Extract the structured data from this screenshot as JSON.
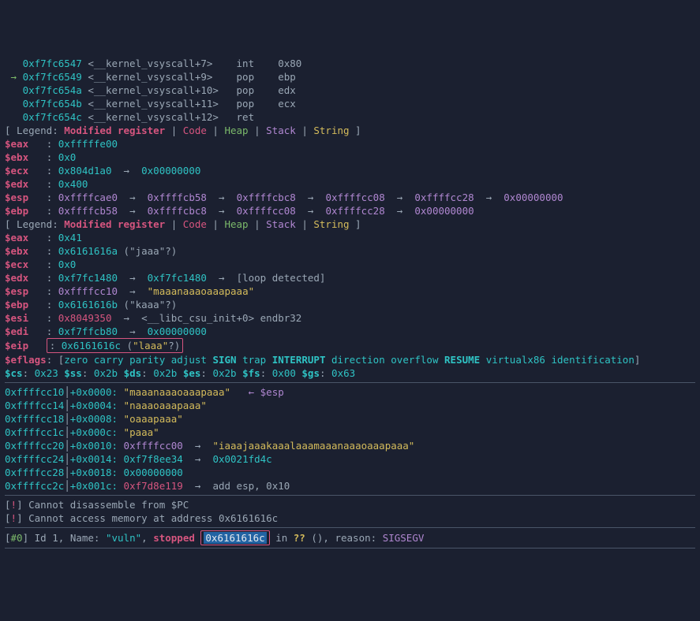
{
  "disasm": [
    {
      "addr": "0xf7fc6547",
      "sym": "<__kernel_vsyscall+7>",
      "mnem": "int",
      "ops": "0x80",
      "arrow": false
    },
    {
      "addr": "0xf7fc6549",
      "sym": "<__kernel_vsyscall+9>",
      "mnem": "pop",
      "ops": "ebp",
      "arrow": true
    },
    {
      "addr": "0xf7fc654a",
      "sym": "<__kernel_vsyscall+10>",
      "mnem": "pop",
      "ops": "edx",
      "arrow": false
    },
    {
      "addr": "0xf7fc654b",
      "sym": "<__kernel_vsyscall+11>",
      "mnem": "pop",
      "ops": "ecx",
      "arrow": false
    },
    {
      "addr": "0xf7fc654c",
      "sym": "<__kernel_vsyscall+12>",
      "mnem": "ret",
      "ops": "",
      "arrow": false
    }
  ],
  "legend": {
    "prefix": "[ Legend: ",
    "mod": "Modified register",
    "code": "Code",
    "heap": "Heap",
    "stack": "Stack",
    "string": "String",
    "suffix": " ]"
  },
  "regs1": {
    "eax": {
      "val": "0xfffffe00"
    },
    "ebx": {
      "val": "0x0"
    },
    "ecx": {
      "val": "0x804d1a0",
      "chain": [
        "0x00000000"
      ]
    },
    "edx": {
      "val": "0x400"
    },
    "esp": {
      "val": "0xffffcae0",
      "chain": [
        "0xffffcb58",
        "0xffffcbc8",
        "0xffffcc08",
        "0xffffcc28",
        "0x00000000"
      ]
    },
    "ebp": {
      "val": "0xffffcb58",
      "chain": [
        "0xffffcbc8",
        "0xffffcc08",
        "0xffffcc28",
        "0x00000000"
      ]
    }
  },
  "regs2": {
    "eax": {
      "val": "0x41"
    },
    "ebx": {
      "val": "0x6161616a",
      "note": "(\"jaaa\"?)"
    },
    "ecx": {
      "val": "0x0"
    },
    "edx": {
      "val": "0xf7fc1480",
      "chain": [
        "0xf7fc1480"
      ],
      "tail": "[loop detected]"
    },
    "esp": {
      "val": "0xffffcc10",
      "str": "\"maaanaaaoaaapaaa\""
    },
    "ebp": {
      "val": "0x6161616b",
      "note": "(\"kaaa\"?)"
    },
    "esi": {
      "val": "0x8049350",
      "sym": "<__libc_csu_init+0> endbr32"
    },
    "edi": {
      "val": "0xf7ffcb80",
      "chain": [
        "0x00000000"
      ]
    },
    "eip": {
      "val": "0x6161616c",
      "note": "(\"laaa\"?)"
    },
    "eflags": {
      "val": "[zero carry parity adjust SIGN trap INTERRUPT direction overflow RESUME virtualx86 identification]",
      "bold": [
        "SIGN",
        "INTERRUPT",
        "RESUME"
      ]
    },
    "cs": "0x23",
    "ss": "0x2b",
    "ds": "0x2b",
    "es": "0x2b",
    "fs": "0x00",
    "gs": "0x63"
  },
  "stack": [
    {
      "addr": "0xffffcc10",
      "off": "+0x0000:",
      "val": "\"maaanaaaoaaapaaa\"",
      "esp": true,
      "valcls": "yellow"
    },
    {
      "addr": "0xffffcc14",
      "off": "+0x0004:",
      "val": "\"naaaoaaapaaa\"",
      "valcls": "yellow"
    },
    {
      "addr": "0xffffcc18",
      "off": "+0x0008:",
      "val": "\"oaaapaaa\"",
      "valcls": "yellow"
    },
    {
      "addr": "0xffffcc1c",
      "off": "+0x000c:",
      "val": "\"paaa\"",
      "valcls": "yellow"
    },
    {
      "addr": "0xffffcc20",
      "off": "+0x0010:",
      "val": "0xffffcc00",
      "arrow": true,
      "tail": "\"iaaajaaakaaalaaamaaanaaaoaaapaaa\"",
      "valcls": "purple",
      "tailcls": "yellow"
    },
    {
      "addr": "0xffffcc24",
      "off": "+0x0014:",
      "val": "0xf7f8ee34",
      "arrow": true,
      "tail": "0x0021fd4c",
      "valcls": "cyan",
      "tailcls": "cyan"
    },
    {
      "addr": "0xffffcc28",
      "off": "+0x0018:",
      "val": "0x00000000",
      "valcls": "cyan"
    },
    {
      "addr": "0xffffcc2c",
      "off": "+0x001c:",
      "val": "0xf7d8e119",
      "arrow": true,
      "tail": "add esp, 0x10",
      "valcls": "red",
      "tailcls": "grey"
    }
  ],
  "warn": [
    "Cannot disassemble from $PC",
    "Cannot access memory at address 0x6161616c"
  ],
  "frame": {
    "id": "#0",
    "idlbl": "Id",
    "idval": "1",
    "namelbl": "Name:",
    "name": "\"vuln\"",
    "stopped": "stopped",
    "addr": "0x6161616c",
    "in": "in",
    "qq": "??",
    "parens": "()",
    "reasonlbl": "reason:",
    "reason": "SIGSEGV",
    "comma": ", "
  }
}
